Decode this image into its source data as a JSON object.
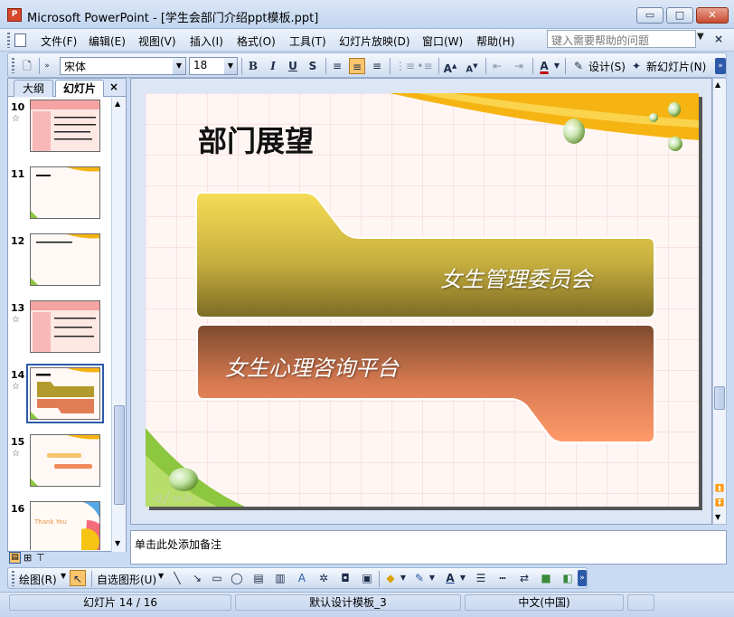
{
  "window": {
    "title": "Microsoft PowerPoint - [学生会部门介绍ppt模板.ppt]",
    "minimize": "▭",
    "maximize": "□",
    "close": "✕"
  },
  "menu": {
    "items": [
      "文件(F)",
      "编辑(E)",
      "视图(V)",
      "插入(I)",
      "格式(O)",
      "工具(T)",
      "幻灯片放映(D)",
      "窗口(W)",
      "帮助(H)"
    ],
    "help_placeholder": "键入需要帮助的问题",
    "close_doc": "×"
  },
  "toolbar": {
    "font_name": "宋体",
    "font_size": "18",
    "bold": "B",
    "italic": "I",
    "underline": "U",
    "shadow": "S",
    "design": "设计(S)",
    "new_slide": "新幻灯片(N)"
  },
  "panel": {
    "tab_outline": "大纲",
    "tab_slides": "幻灯片",
    "close": "×",
    "thumbs": [
      {
        "num": "10"
      },
      {
        "num": "11"
      },
      {
        "num": "12"
      },
      {
        "num": "13"
      },
      {
        "num": "14"
      },
      {
        "num": "15"
      },
      {
        "num": "16"
      }
    ],
    "thumb16_text": "Thank You"
  },
  "slide": {
    "title": "部门展望",
    "item1": "女生管理委员会",
    "item2": "女生心理咨询平台"
  },
  "notes": {
    "placeholder": "单击此处添加备注"
  },
  "drawing": {
    "draw_label": "绘图(R)",
    "autoshapes_label": "自选图形(U)"
  },
  "status": {
    "slide_info": "幻灯片 14 / 16",
    "template": "默认设计模板_3",
    "language": "中文(中国)"
  },
  "colors": {
    "accent_yellow": "#f6b413",
    "tab_gold": "#b39a2c",
    "tab_salmon": "#f08a5d"
  }
}
